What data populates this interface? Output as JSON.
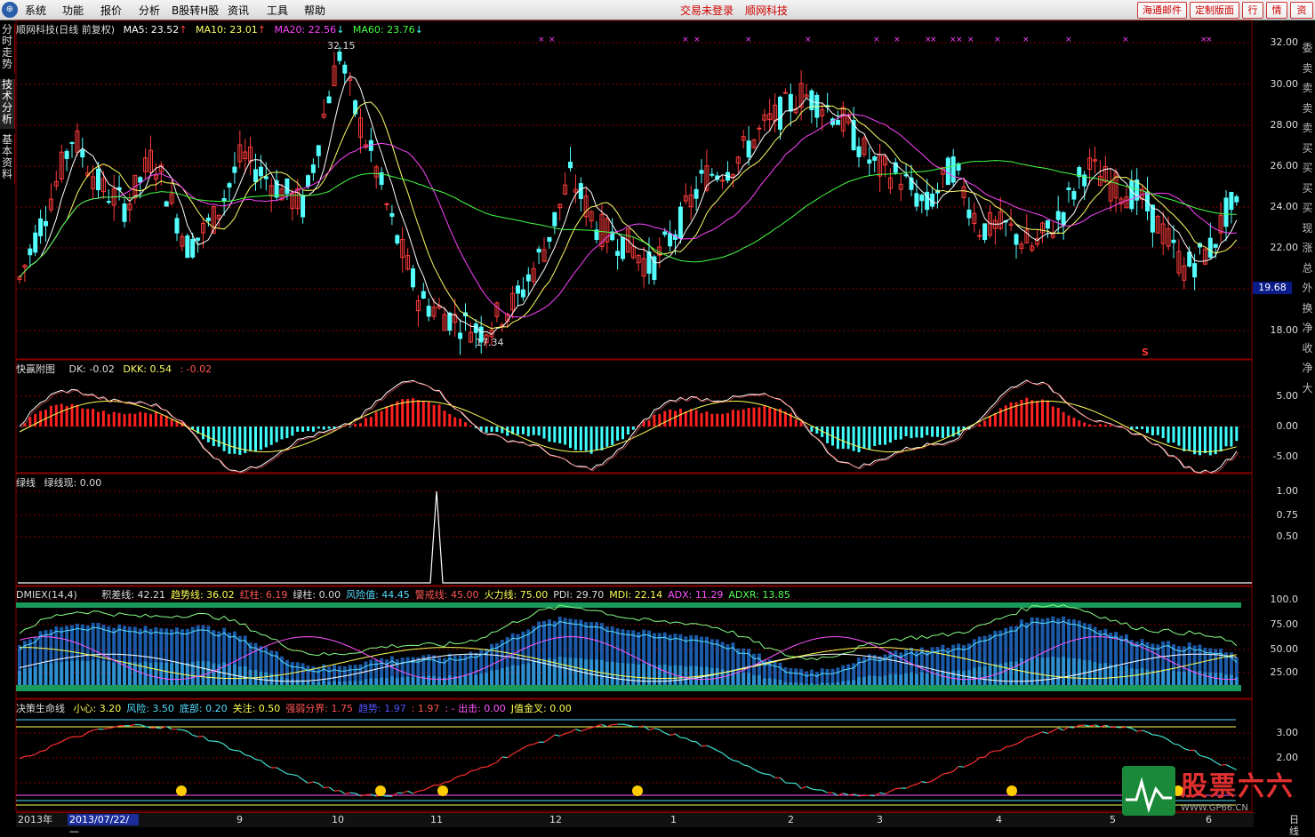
{
  "menu": {
    "items": [
      "系统",
      "功能",
      "报价",
      "分析",
      "B股转H股",
      "资讯",
      "工具",
      "帮助"
    ],
    "status_login": "交易未登录",
    "status_broker": "顺网科技",
    "buttons": [
      "海通邮件",
      "定制版面",
      "行",
      "情",
      "资"
    ]
  },
  "leftnav": {
    "tabs": [
      "分时走势",
      "技术分析",
      "基本资料"
    ],
    "active": 1
  },
  "rightnav": {
    "labels": [
      "委",
      "卖",
      "卖",
      "卖",
      "卖",
      "买",
      "买",
      "买",
      "买",
      "现",
      "涨",
      "总",
      "外",
      "换",
      "净",
      "收",
      "净",
      "大"
    ]
  },
  "main_panel": {
    "title": "顺网科技(日线 前复权)",
    "ma5": "MA5: 23.52",
    "ma10": "MA10: 23.01",
    "ma20": "MA20: 22.56",
    "ma60": "MA60: 23.76",
    "high_label": "32.15",
    "low_label": "17.34",
    "price_tag": "19.68",
    "s_marker": "S",
    "y_ticks": [
      "32.00",
      "30.00",
      "28.00",
      "26.00",
      "24.00",
      "22.00",
      "18.00"
    ]
  },
  "kuaiying": {
    "title": "快赢附图",
    "dk": "DK: -0.02",
    "dkk": "DKK: 0.54",
    "third": ": -0.02",
    "y_ticks": [
      "5.00",
      "0.00",
      "-5.00"
    ]
  },
  "lvxian": {
    "title": "绿线",
    "value": "绿线现: 0.00",
    "y_ticks": [
      "1.00",
      "0.75",
      "0.50"
    ]
  },
  "dmiex": {
    "title": "DMIEX(14,4)",
    "items": [
      {
        "text": "积差线: 42.21",
        "color": "#dddddd"
      },
      {
        "text": "趋势线: 36.02",
        "color": "#ffff55"
      },
      {
        "text": "红柱: 6.19",
        "color": "#ff5555"
      },
      {
        "text": "绿柱: 0.00",
        "color": "#dddddd"
      },
      {
        "text": "风险值: 44.45",
        "color": "#55ddff"
      },
      {
        "text": "警戒线: 45.00",
        "color": "#ff5555"
      },
      {
        "text": "火力线: 75.00",
        "color": "#ffff55"
      },
      {
        "text": "PDI: 29.70",
        "color": "#dddddd"
      },
      {
        "text": "MDI: 22.14",
        "color": "#ffff55"
      },
      {
        "text": "ADX: 11.29",
        "color": "#ff55ff"
      },
      {
        "text": "ADXR: 13.85",
        "color": "#55ff55"
      }
    ],
    "y_ticks": [
      "100.0",
      "75.00",
      "50.00",
      "25.00"
    ]
  },
  "juece": {
    "title": "决策生命线",
    "items": [
      {
        "text": "小心: 3.20",
        "color": "#ffff55"
      },
      {
        "text": "风险: 3.50",
        "color": "#55ddff"
      },
      {
        "text": "底部: 0.20",
        "color": "#55ddff"
      },
      {
        "text": "关注: 0.50",
        "color": "#ffff55"
      },
      {
        "text": "强弱分界: 1.75",
        "color": "#ff5555"
      },
      {
        "text": "趋势: 1.97",
        "color": "#5555ff"
      },
      {
        "text": ": 1.97",
        "color": "#ff5555"
      },
      {
        "text": ": - 出击: 0.00",
        "color": "#ff55ff"
      },
      {
        "text": "J值金叉: 0.00",
        "color": "#ffff55"
      }
    ],
    "y_ticks": [
      "3.00",
      "2.00"
    ]
  },
  "bottom": {
    "year": "2013年",
    "date": "2013/07/22/—",
    "months": [
      "9",
      "10",
      "11",
      "12",
      "1",
      "2",
      "3",
      "4",
      "5",
      "6"
    ],
    "period": "日线"
  },
  "watermark": {
    "text": "股票六六",
    "url": "WWW.GP66.CN"
  },
  "colors": {
    "up": "#ff3b3b",
    "down": "#54ffff",
    "grid": "#8a0000",
    "ma5": "#ffffff",
    "ma10": "#ffff66",
    "ma20": "#ff44ff",
    "ma60": "#44ff44"
  }
}
